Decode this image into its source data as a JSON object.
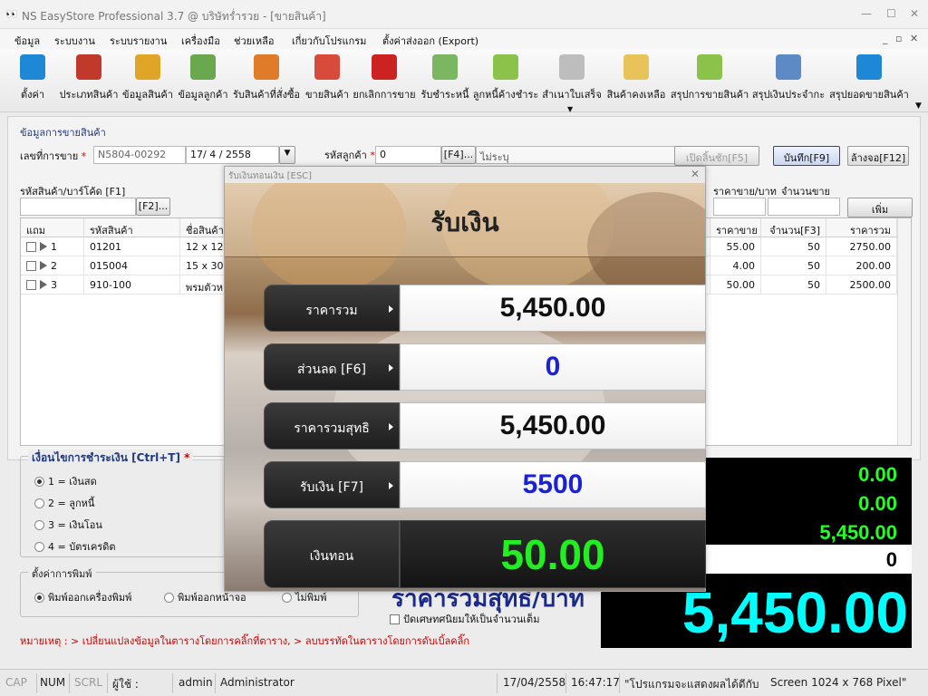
{
  "window": {
    "title": "NS EasyStore Professional 3.7 @ บริษัทร่ำรวย - [ขายสินค้า]"
  },
  "menu": [
    "ข้อมูล",
    "ระบบงาน",
    "ระบบรายงาน",
    "เครื่องมือ",
    "ช่วยเหลือ",
    "เกี่ยวกับโปรแกรม",
    "ตั้งค่าส่งออก (Export)"
  ],
  "toolbar": [
    {
      "label": "ตั้งค่า",
      "icon": "gear-icon",
      "color": "#1e88d6"
    },
    {
      "label": "ประเภทสินค้า",
      "icon": "binders-icon",
      "color": "#c0392b"
    },
    {
      "label": "ข้อมูลสินค้า",
      "icon": "barcode-scanner-icon",
      "color": "#e0a526"
    },
    {
      "label": "ข้อมูลลูกค้า",
      "icon": "people-icon",
      "color": "#6aa84f"
    },
    {
      "label": "รับสินค้าที่สั่งซื้อ",
      "icon": "folder-icon",
      "color": "#e07b2a"
    },
    {
      "label": "ขายสินค้า",
      "icon": "cart-icon",
      "color": "#d84a3a"
    },
    {
      "label": "ยกเลิกการขาย",
      "icon": "cancel-cart-icon",
      "color": "#cc2222"
    },
    {
      "label": "รับชำระหนี้",
      "icon": "money-icon",
      "color": "#7bb661"
    },
    {
      "label": "ลูกหนี้ค้างชำระ",
      "icon": "note-icon",
      "color": "#8bc34a"
    },
    {
      "label": "สำเนาใบเสร็จ",
      "icon": "copy-icon",
      "color": "#bdbdbd"
    },
    {
      "label": "สินค้าคงเหลือ",
      "icon": "pencil-icon",
      "color": "#e7c35a"
    },
    {
      "label": "สรุปการขายสินค้า",
      "icon": "sales-summary-icon",
      "color": "#8bc34a"
    },
    {
      "label": "สรุปเงินประจำกะ",
      "icon": "shift-summary-icon",
      "color": "#5d8ac4"
    },
    {
      "label": "สรุปยอดขายสินค้า",
      "icon": "bar-chart-icon",
      "color": "#1e88d6"
    }
  ],
  "form": {
    "group_title": "ข้อมูลการขายสินค้า",
    "sale_no_label": "เลขที่การขาย",
    "sale_no": "N5804-00292",
    "date": "17/ 4 / 2558",
    "customer_label": "รหัสลูกค้า",
    "customer_code": "0",
    "f4_button": "[F4]...",
    "customer_name": "ไม่ระบุ",
    "open_drawer": "เปิดลิ้นชัก[F5]",
    "save": "บันทึก[F9]",
    "clear": "ล้างจอ[F12]",
    "barcode_label": "รหัสสินค้า/บาร์โค้ด [F1]",
    "f2_button": "[F2]...",
    "price_label": "ราคาขาย/บาท",
    "qty_label": "จำนวนขาย",
    "add_button": "เพิ่ม"
  },
  "grid": {
    "headers": [
      "แถม",
      "รหัสสินค้า",
      "ชื่อสินค้า",
      "ราคาขาย",
      "จำนวน[F3]",
      "ราคารวม"
    ],
    "rows": [
      {
        "no": "1",
        "code": "01201",
        "name": "12 x 12",
        "price": "55.00",
        "qty": "50",
        "total": "2750.00"
      },
      {
        "no": "2",
        "code": "015004",
        "name": "15 x 30",
        "price": "4.00",
        "qty": "50",
        "total": "200.00"
      },
      {
        "no": "3",
        "code": "910-100",
        "name": "พรมตัวห",
        "price": "50.00",
        "qty": "50",
        "total": "2500.00"
      }
    ]
  },
  "payment": {
    "title": "เงื่อนไขการชำระเงิน [Ctrl+T]",
    "options": [
      "1 = เงินสด",
      "2 = ลูกหนี้",
      "3 = เงินโอน",
      "4 = บัตรเครดิต"
    ]
  },
  "print": {
    "title": "ตั้งค่าการพิมพ์",
    "options": [
      "พิมพ์ออกเครื่องพิมพ์",
      "พิมพ์ออกหน้าจอ",
      "ไม่พิมพ์"
    ]
  },
  "net_total_label": "ราคารวมสุทธิ/บาท",
  "round_checkbox": "ปัดเศษทศนิยมให้เป็นจำนวนเต็ม",
  "note": {
    "prefix": "หมายเหตุ :",
    "items": [
      "> เปลี่ยนแปลงข้อมูลในตารางโดยการคลิ๊กที่ตาราง,",
      "> ลบบรรทัดในตารางโดยการดับเบิ้ลคลิ๊ก"
    ]
  },
  "summary": {
    "v1": "0.00",
    "v2": "0.00",
    "v3": "5,450.00",
    "v4": "0",
    "big": "5,450.00"
  },
  "dialog": {
    "title": "รับเงินทอนเงิน [ESC]",
    "heading": "รับเงิน",
    "rows": [
      {
        "label": "ราคารวม",
        "value": "5,450.00",
        "color": "#111111"
      },
      {
        "label": "ส่วนลด [F6]",
        "value": "0",
        "color": "#1a22d8"
      },
      {
        "label": "ราคารวมสุทธิ",
        "value": "5,450.00",
        "color": "#111111"
      },
      {
        "label": "รับเงิน [F7]",
        "value": "5500",
        "color": "#1a22d8"
      }
    ],
    "change_label": "เงินทอน",
    "change_value": "50.00"
  },
  "status": {
    "cap": "CAP",
    "num": "NUM",
    "scrl": "SCRL",
    "user_label": "ผู้ใช้ :",
    "user_id": "admin",
    "user_name": "Administrator",
    "date": "17/04/2558",
    "time": "16:47:17",
    "msg": "\"โปรแกรมจะแสดงผลได้ดีกับ",
    "screen": "Screen 1024 x 768 Pixel\""
  }
}
